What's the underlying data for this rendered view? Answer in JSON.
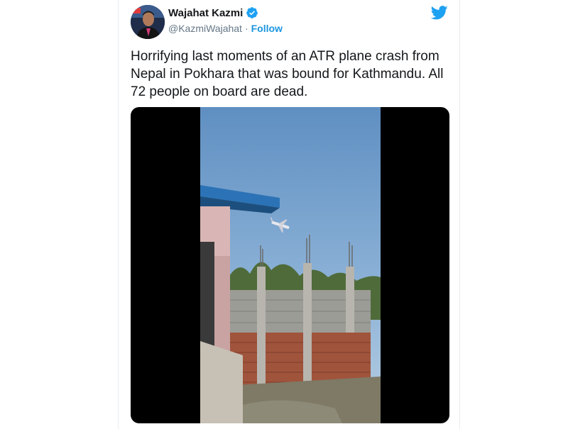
{
  "tweet": {
    "author": {
      "name": "Wajahat Kazmi",
      "handle": "@KazmiWajahat",
      "verified": true,
      "avatar_icon": "avatar-photo"
    },
    "follow_label": "Follow",
    "separator": "·",
    "text": "Horrifying last moments of an ATR plane crash from Nepal in Pokhara that was bound for Kathmandu. All 72 people on board are dead.",
    "brand_icon": "twitter-bird-icon",
    "media": {
      "type": "video",
      "scene": "video-frame"
    }
  },
  "colors": {
    "link": "#1b95e0",
    "text": "#14171a",
    "secondary": "#657786",
    "twitter_blue": "#1da1f2"
  }
}
